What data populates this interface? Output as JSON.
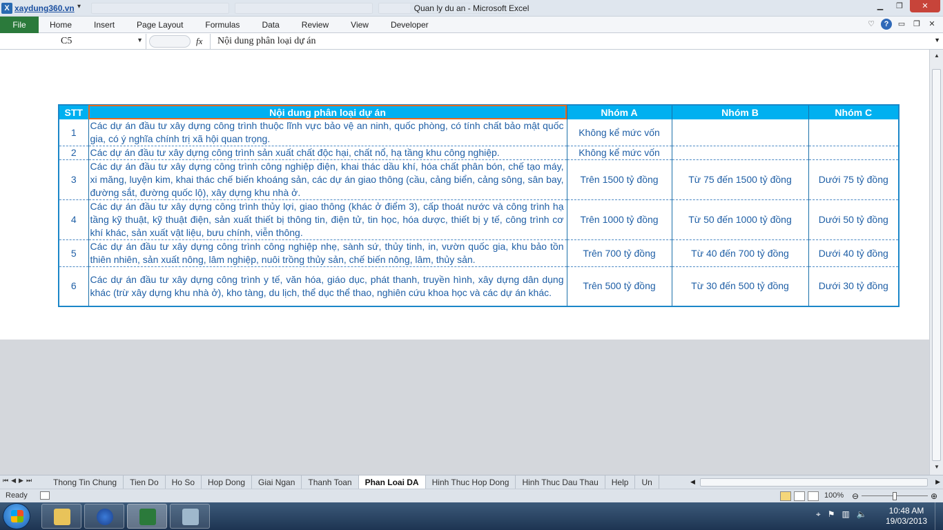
{
  "titlebar": {
    "site_logo": "xaydung360.vn",
    "window_title": "Quan ly du an  -  Microsoft Excel",
    "controls": [
      "minimize",
      "restore",
      "close"
    ]
  },
  "ribbon": {
    "file_tab": "File",
    "tabs": [
      "Home",
      "Insert",
      "Page Layout",
      "Formulas",
      "Data",
      "Review",
      "View",
      "Developer"
    ]
  },
  "formula_bar": {
    "name_box": "C5",
    "fx_label": "fx",
    "content": "Nội dung phân loại dự án"
  },
  "table": {
    "headers": [
      "STT",
      "Nội dung phân loại dự án",
      "Nhóm A",
      "Nhóm B",
      "Nhóm C"
    ],
    "rows": [
      {
        "stt": "1",
        "content": "Các dự án đầu tư xây dựng công trình thuộc lĩnh vực bảo vệ an ninh, quốc phòng, có tính chất bảo mật quốc gia, có ý nghĩa chính trị xã hội quan trọng.",
        "a": "Không kể mức vốn",
        "b": "",
        "c": ""
      },
      {
        "stt": "2",
        "content": "Các dự án đầu tư xây dựng công trình sản xuất chất độc hại, chất nổ, hạ tầng khu công nghiệp.",
        "a": "Không kể mức vốn",
        "b": "",
        "c": ""
      },
      {
        "stt": "3",
        "content": "Các dự án đầu tư xây dựng công trình công nghiệp điện, khai thác dầu khí, hóa chất phân bón, chế tạo máy, xi măng, luyện kim, khai thác chế biến khoáng sản, các dự án giao thông (cầu, cảng biển, cảng sông, sân bay, đường sắt, đường quốc lộ), xây dựng khu nhà ở.",
        "a": "Trên 1500 tỷ đồng",
        "b": "Từ 75 đến 1500 tỷ đồng",
        "c": "Dưới 75 tỷ đồng"
      },
      {
        "stt": "4",
        "content": "Các dự án đầu tư xây dựng công trình thủy lợi, giao thông (khác ở điểm 3), cấp thoát nước và công trình hạ tầng kỹ thuật, kỹ thuật điện, sản xuất thiết bị thông tin, điện tử, tin học, hóa dược, thiết bị y tế, công trình cơ khí khác, sản xuất vật liệu, bưu chính, viễn thông.",
        "a": "Trên 1000 tỷ đồng",
        "b": "Từ 50 đến 1000 tỷ đồng",
        "c": "Dưới 50 tỷ đồng"
      },
      {
        "stt": "5",
        "content": "Các dự án đầu tư xây dựng công trình công nghiệp nhẹ, sành sứ, thủy tinh, in, vườn quốc gia, khu bảo tồn thiên nhiên, sản xuất nông, lâm nghiệp, nuôi trồng thủy sản, chế biến nông, lâm, thủy sản.",
        "a": "Trên 700 tỷ đồng",
        "b": "Từ 40 đến 700 tỷ đồng",
        "c": "Dưới 40 tỷ đồng"
      },
      {
        "stt": "6",
        "content": "Các dự án đầu tư xây dựng công trình y tế, văn hóa, giáo dục, phát thanh, truyền hình, xây dựng dân dụng khác (trừ xây dựng khu nhà ở), kho tàng, du lịch, thể dục thể thao, nghiên cứu khoa học và các dự án khác.",
        "a": "Trên 500 tỷ đồng",
        "b": "Từ 30 đến 500 tỷ đồng",
        "c": "Dưới 30 tỷ đồng"
      }
    ]
  },
  "sheet_tabs": {
    "tabs": [
      "Thong Tin Chung",
      "Tien Do",
      "Ho So",
      "Hop Dong",
      "Giai Ngan",
      "Thanh Toan",
      "Phan Loai DA",
      "Hinh Thuc Hop Dong",
      "Hinh Thuc Dau Thau",
      "Help",
      "Un"
    ],
    "active": "Phan Loai DA"
  },
  "status_bar": {
    "ready": "Ready",
    "zoom": "100%",
    "zoom_fraction": 0.5
  },
  "taskbar": {
    "time": "10:48 AM",
    "date": "19/03/2013"
  },
  "colors": {
    "header_bg": "#00b0f0",
    "table_text": "#1f5fa6",
    "selection": "#e86a1c",
    "file_tab": "#2b7a3b"
  }
}
